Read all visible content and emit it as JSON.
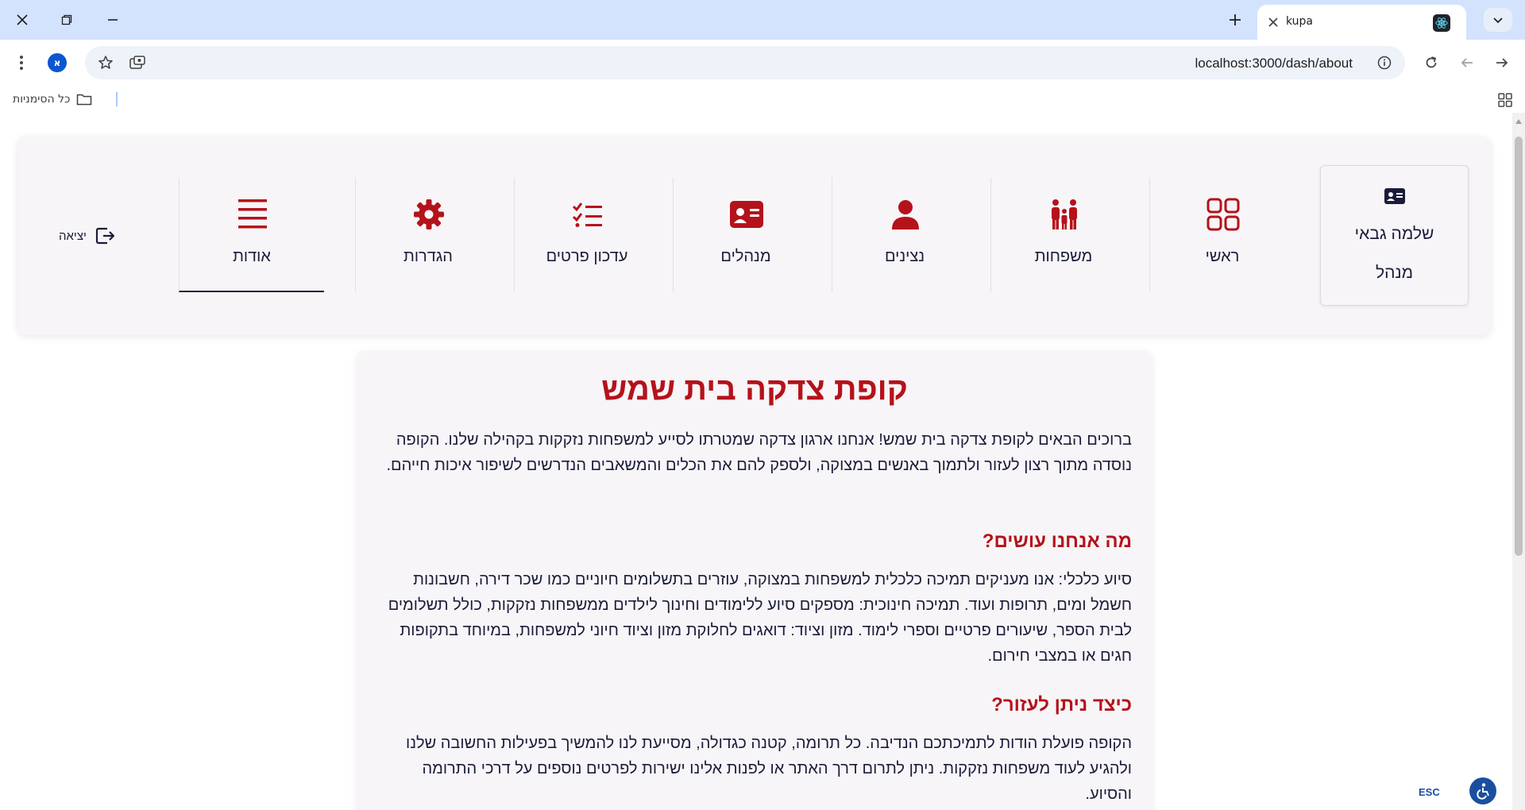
{
  "browser": {
    "tab_title": "kupa",
    "url": "localhost:3000/dash/about",
    "profile_initial": "א",
    "bookmarks_all_label": "כל הסימניות"
  },
  "nav": {
    "user_name": "שלמה גבאי",
    "user_role": "מנהל",
    "items": [
      {
        "label": "ראשי",
        "icon": "grid-icon"
      },
      {
        "label": "משפחות",
        "icon": "family-icon"
      },
      {
        "label": "נצינים",
        "icon": "person-icon"
      },
      {
        "label": "מנהלים",
        "icon": "id-card-icon"
      },
      {
        "label": "עדכון פרטים",
        "icon": "checklist-icon"
      },
      {
        "label": "הגדרות",
        "icon": "gear-icon"
      },
      {
        "label": "אודות",
        "icon": "menu-lines-icon"
      }
    ],
    "active_item": "אודות",
    "logout_label": "יציאה"
  },
  "about": {
    "title": "קופת צדקה בית שמש",
    "intro": "ברוכים הבאים לקופת צדקה בית שמש! אנחנו ארגון צדקה שמטרתו לסייע למשפחות נזקקות בקהילה שלנו. הקופה נוסדה מתוך רצון לעזור ולתמוך באנשים במצוקה, ולספק להם את הכלים והמשאבים הנדרשים לשיפור איכות חייהם.",
    "what_heading": "מה אנחנו עושים?",
    "what_text": "סיוע כלכלי: אנו מעניקים תמיכה כלכלית למשפחות במצוקה, עוזרים בתשלומים חיוניים כמו שכר דירה, חשבונות חשמל ומים, תרופות ועוד. תמיכה חינוכית: מספקים סיוע ללימודים וחינוך לילדים ממשפחות נזקקות, כולל תשלומים לבית הספר, שיעורים פרטיים וספרי לימוד. מזון וציוד: דואגים לחלוקת מזון וציוד חיוני למשפחות, במיוחד בתקופות חגים או במצבי חירום.",
    "help_heading": "כיצד ניתן לעזור?",
    "help_text": "הקופה פועלת הודות לתמיכתכם הנדיבה. כל תרומה, קטנה כגדולה, מסייעת לנו להמשיך בפעילות החשובה שלנו ולהגיע לעוד משפחות נזקקות. ניתן לתרום דרך האתר או לפנות אלינו ישירות לפרטים נוספים על דרכי התרומה והסיוע."
  },
  "widgets": {
    "esc_label": "ESC"
  },
  "colors": {
    "accent_red": "#b5121b",
    "text_navy": "#1c1c3a",
    "card_bg": "#f7f5f7",
    "chrome_blue": "#d3e3fd"
  }
}
